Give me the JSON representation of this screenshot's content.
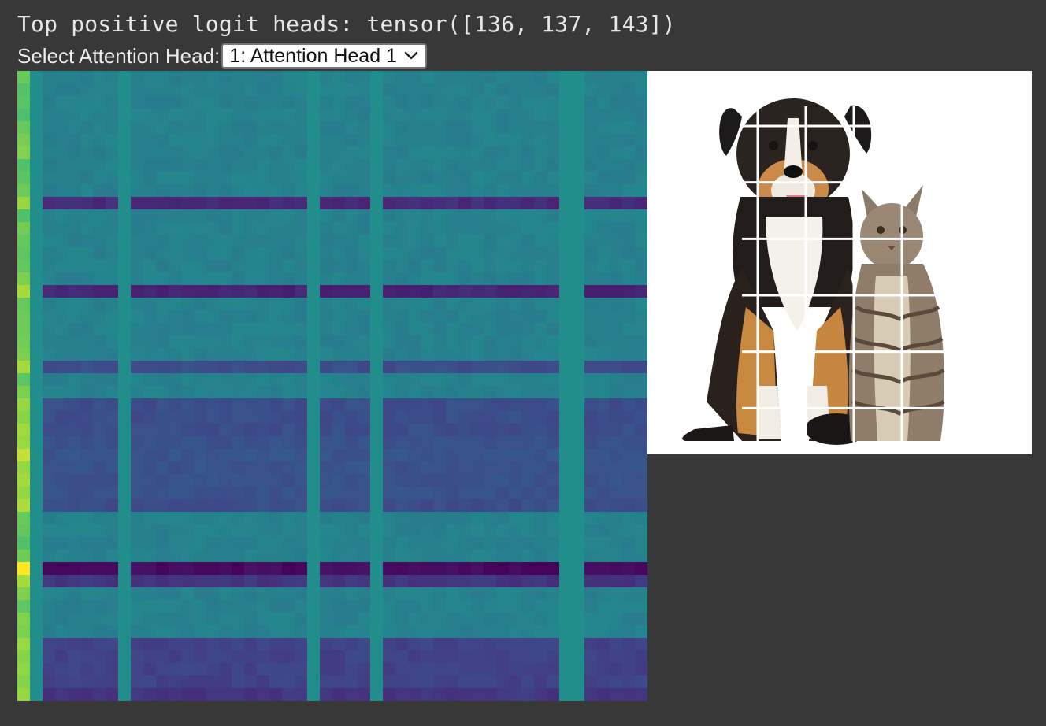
{
  "output": {
    "text": "Top positive logit heads: tensor([136, 137, 143])"
  },
  "selector": {
    "label": "Select Attention Head:",
    "selected": "1: Attention Head 1"
  },
  "heatmap": {
    "colormap": "viridis",
    "grid_size": 50,
    "low_color": "#440154",
    "high_color": "#fde725"
  },
  "image": {
    "subject": "dog-and-cat-photo",
    "grid_rows": 6,
    "grid_cols": 4,
    "background": "#ffffff"
  }
}
